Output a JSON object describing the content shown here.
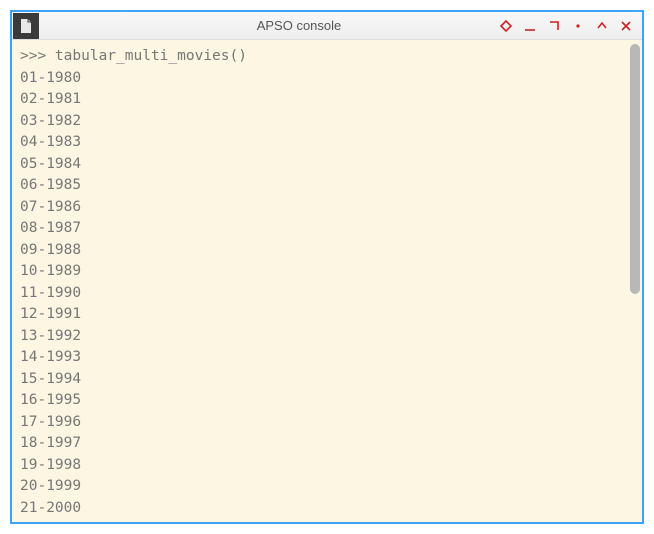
{
  "window": {
    "title": "APSO console"
  },
  "console": {
    "prompt": ">>> ",
    "command": "tabular_multi_movies()",
    "output_lines": [
      "01-1980",
      "02-1981",
      "03-1982",
      "04-1983",
      "05-1984",
      "06-1985",
      "07-1986",
      "08-1987",
      "09-1988",
      "10-1989",
      "11-1990",
      "12-1991",
      "13-1992",
      "14-1993",
      "15-1994",
      "16-1995",
      "17-1996",
      "18-1997",
      "19-1998",
      "20-1999",
      "21-2000"
    ]
  }
}
